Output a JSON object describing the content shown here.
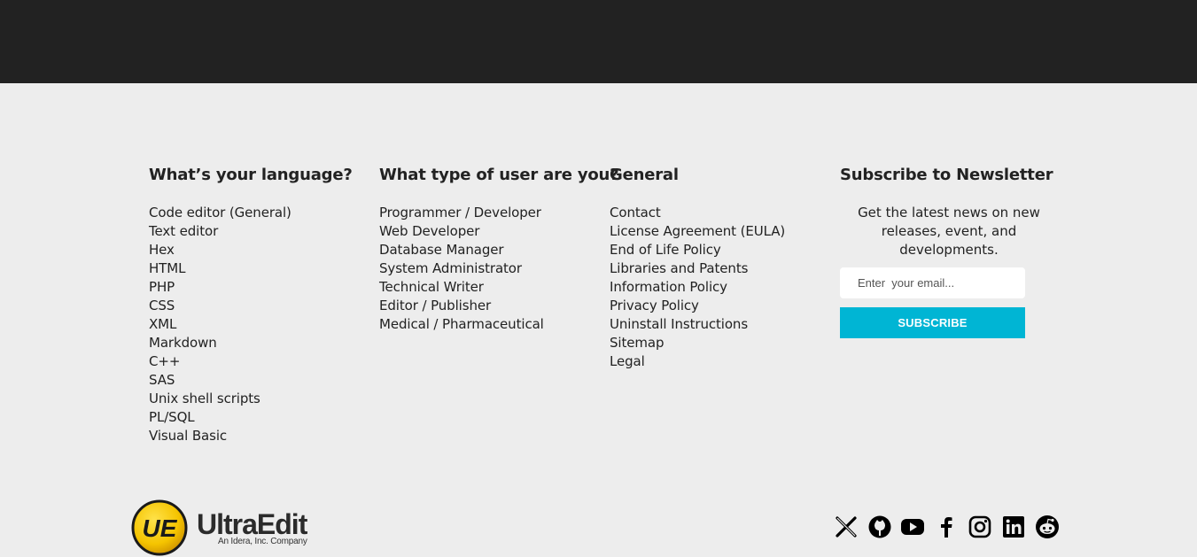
{
  "columns": {
    "language": {
      "title": "What’s your language?",
      "items": [
        "Code editor (General)",
        "Text editor",
        "Hex",
        "HTML",
        "PHP",
        "CSS",
        "XML",
        "Markdown",
        "C++",
        "SAS",
        "Unix shell scripts",
        "PL/SQL",
        "Visual Basic"
      ]
    },
    "user_type": {
      "title": "What type of user are you?",
      "items": [
        "Programmer / Developer",
        "Web Developer",
        "Database Manager",
        "System Administrator",
        "Technical Writer",
        "Editor / Publisher",
        "Medical / Pharmaceutical"
      ]
    },
    "general": {
      "title": "General",
      "items": [
        "Contact",
        "License Agreement (EULA)",
        "End of Life Policy",
        "Libraries and Patents",
        "Information Policy",
        "Privacy Policy",
        "Uninstall Instructions",
        "Sitemap",
        "Legal"
      ]
    }
  },
  "newsletter": {
    "title": "Subscribe to Newsletter",
    "description": "Get the latest news on new releases, event, and developments.",
    "email_placeholder": "Enter  your email...",
    "email_value": "",
    "button_label": "Subscribe"
  },
  "logo": {
    "mark": "UE",
    "name": "UltraEdit",
    "tagline": "An Idera, Inc. Company"
  },
  "social": [
    "x-icon",
    "github-icon",
    "youtube-icon",
    "facebook-icon",
    "instagram-icon",
    "linkedin-icon",
    "reddit-icon"
  ],
  "colors": {
    "topbar": "#222222",
    "background": "#ededed",
    "accent": "#00b5d4",
    "logo_yellow": "#f5c400"
  }
}
